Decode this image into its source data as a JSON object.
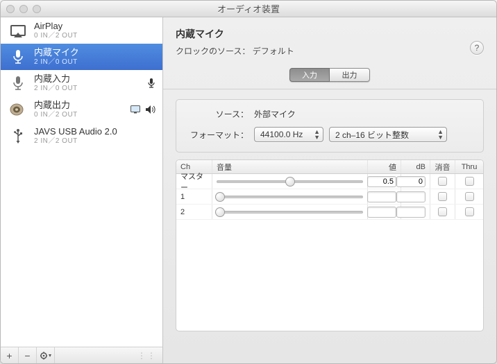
{
  "window": {
    "title": "オーディオ装置"
  },
  "sidebar": {
    "devices": [
      {
        "name": "AirPlay",
        "io": "0 IN／2 OUT",
        "icon": "airplay"
      },
      {
        "name": "内蔵マイク",
        "io": "2 IN／0 OUT",
        "icon": "mic",
        "selected": true
      },
      {
        "name": "内蔵入力",
        "io": "2 IN／0 OUT",
        "icon": "mic",
        "right": "mic"
      },
      {
        "name": "内蔵出力",
        "io": "0 IN／2 OUT",
        "icon": "speaker",
        "right": "display-speaker"
      },
      {
        "name": "JAVS USB Audio 2.0",
        "io": "2 IN／2 OUT",
        "icon": "usb"
      }
    ],
    "footer": {
      "plus": "+",
      "minus": "−",
      "gear": "✻"
    }
  },
  "main": {
    "title": "内蔵マイク",
    "clockLabel": "クロックのソース：",
    "clockValue": "デフォルト",
    "tabs": {
      "input": "入力",
      "output": "出力"
    },
    "sourceLabel": "ソース：",
    "sourceValue": "外部マイク",
    "formatLabel": "フォーマット：",
    "formatHz": "44100.0 Hz",
    "formatBits": "2 ch–16 ビット整数",
    "table": {
      "headers": {
        "ch": "Ch",
        "vol": "音量",
        "val": "値",
        "db": "dB",
        "mute": "消音",
        "thru": "Thru"
      },
      "rows": [
        {
          "ch": "マスター",
          "pos": 0.5,
          "val": "0.5",
          "db": "0"
        },
        {
          "ch": "1",
          "pos": 0.0,
          "val": "",
          "db": ""
        },
        {
          "ch": "2",
          "pos": 0.0,
          "val": "",
          "db": ""
        }
      ]
    }
  }
}
